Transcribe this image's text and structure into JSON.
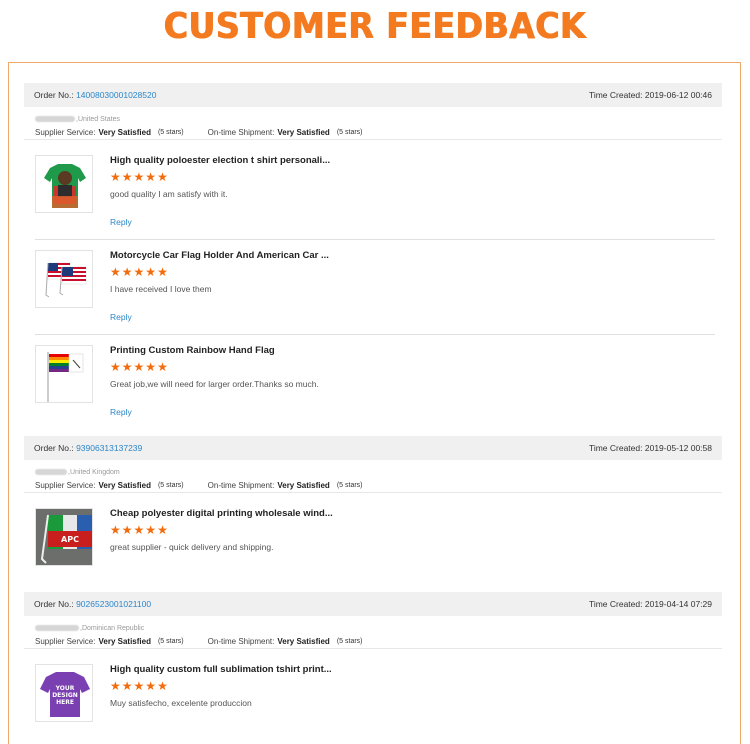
{
  "page_title": "CUSTOMER FEEDBACK",
  "labels": {
    "order_no": "Order No.:",
    "time_created": "Time Created:",
    "supplier_service": "Supplier Service:",
    "ontime_shipment": "On-time Shipment:",
    "reply": "Reply",
    "star_glyph": "★"
  },
  "colors": {
    "accent": "#f47a20",
    "link": "#2b86c8",
    "star": "#f26c0d",
    "header_bg": "#f0f0f0"
  },
  "orders": [
    {
      "order_no": "14008030001028520",
      "time_created": "2019-06-12 00:46",
      "buyer_country": ",United States",
      "supplier_service": "Very Satisfied",
      "supplier_stars": "(5 stars)",
      "shipment": "Very Satisfied",
      "shipment_stars": "(5 stars)",
      "items": [
        {
          "title": "High quality poloester election t shirt personali...",
          "rating": 5,
          "comment": "good quality I am satisfy with it.",
          "thumb_icon": "green-tshirt-icon"
        },
        {
          "title": "Motorcycle Car Flag Holder And American Car ...",
          "rating": 5,
          "comment": "I have received I love them",
          "thumb_icon": "american-car-flag-icon"
        },
        {
          "title": "Printing Custom Rainbow Hand Flag",
          "rating": 5,
          "comment": "Great job,we will need for larger order.Thanks so much.",
          "thumb_icon": "rainbow-hand-flag-icon"
        }
      ]
    },
    {
      "order_no": "93906313137239",
      "time_created": "2019-05-12 00:58",
      "buyer_country": ",United Kingdom",
      "supplier_service": "Very Satisfied",
      "supplier_stars": "(5 stars)",
      "shipment": "Very Satisfied",
      "shipment_stars": "(5 stars)",
      "items": [
        {
          "title": "Cheap polyester digital printing wholesale wind...",
          "rating": 5,
          "comment": "great supplier - quick delivery and shipping.",
          "thumb_icon": "apc-car-flag-icon",
          "thumb_text": "APC"
        }
      ]
    },
    {
      "order_no": "9026523001021100",
      "time_created": "2019-04-14 07:29",
      "buyer_country": ",Dominican Republic",
      "supplier_service": "Very Satisfied",
      "supplier_stars": "(5 stars)",
      "shipment": "Very Satisfied",
      "shipment_stars": "(5 stars)",
      "items": [
        {
          "title": "High quality custom full sublimation tshirt print...",
          "rating": 5,
          "comment": "Muy satisfecho, excelente produccion",
          "thumb_icon": "purple-tshirt-icon",
          "thumb_text": [
            "YOUR",
            "DESIGN",
            "HERE"
          ]
        }
      ]
    }
  ]
}
